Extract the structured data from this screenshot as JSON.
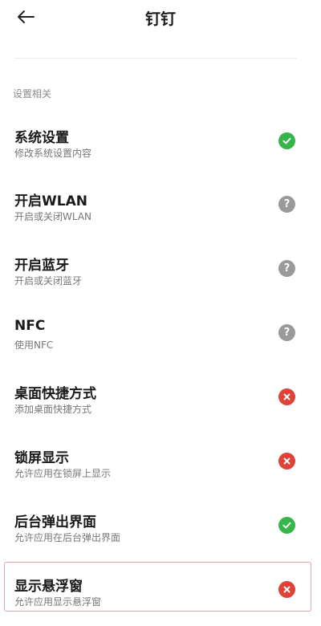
{
  "header": {
    "title": "钉钉",
    "back_icon": "arrow-left-icon"
  },
  "section": {
    "label": "设置相关"
  },
  "colors": {
    "granted": "#35b54a",
    "unknown": "#9a9a9a",
    "denied": "#e04238",
    "highlight": "#e3a6ac"
  },
  "permissions": [
    {
      "name": "系统设置",
      "desc": "修改系统设置内容",
      "status": "granted",
      "icon": "check-circle-icon"
    },
    {
      "name": "开启WLAN",
      "desc": "开启或关闭WLAN",
      "status": "unknown",
      "icon": "question-circle-icon"
    },
    {
      "name": "开启蓝牙",
      "desc": "开启或关闭蓝牙",
      "status": "unknown",
      "icon": "question-circle-icon"
    },
    {
      "name": "NFC",
      "desc": "使用NFC",
      "status": "unknown",
      "icon": "question-circle-icon"
    },
    {
      "name": "桌面快捷方式",
      "desc": "添加桌面快捷方式",
      "status": "denied",
      "icon": "x-circle-icon"
    },
    {
      "name": "锁屏显示",
      "desc": "允许应用在锁屏上显示",
      "status": "denied",
      "icon": "x-circle-icon"
    },
    {
      "name": "后台弹出界面",
      "desc": "允许应用在后台弹出界面",
      "status": "granted",
      "icon": "check-circle-icon"
    },
    {
      "name": "显示悬浮窗",
      "desc": "允许应用显示悬浮窗",
      "status": "denied",
      "icon": "x-circle-icon"
    }
  ]
}
